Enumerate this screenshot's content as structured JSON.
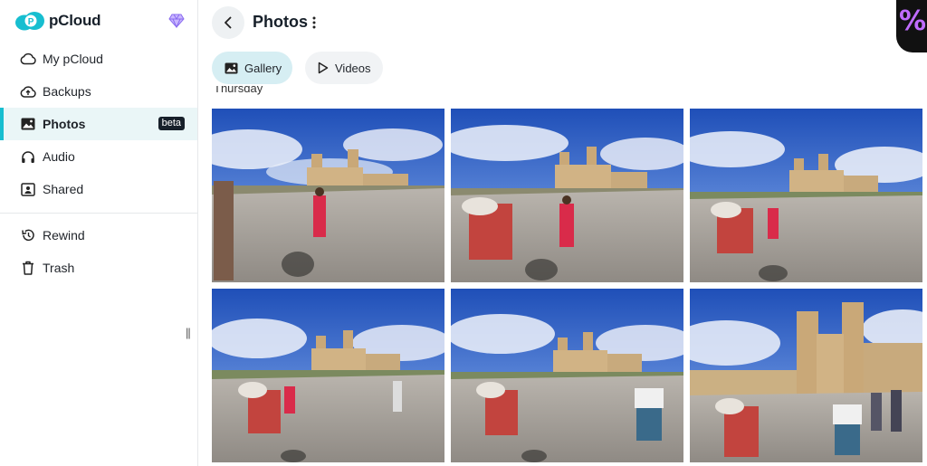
{
  "app": {
    "name": "pCloud"
  },
  "sidebar": {
    "items": [
      {
        "label": "My pCloud",
        "icon": "cloud-icon"
      },
      {
        "label": "Backups",
        "icon": "cloud-upload-icon"
      },
      {
        "label": "Photos",
        "icon": "image-icon",
        "active": true,
        "badge": "beta"
      },
      {
        "label": "Audio",
        "icon": "headphones-icon"
      },
      {
        "label": "Shared",
        "icon": "shared-folder-icon"
      }
    ],
    "secondary": [
      {
        "label": "Rewind",
        "icon": "rewind-icon"
      },
      {
        "label": "Trash",
        "icon": "trash-icon"
      }
    ],
    "collapse_glyph": "||"
  },
  "header": {
    "title": "Photos"
  },
  "tabs": [
    {
      "label": "Gallery",
      "icon": "image-icon",
      "active": true
    },
    {
      "label": "Videos",
      "icon": "play-icon",
      "active": false
    }
  ],
  "section": {
    "label": "Thursday"
  },
  "photos_count": 6,
  "corner_badge": "%",
  "colors": {
    "accent": "#17bed0",
    "active_bg": "#eaf6f7",
    "tab_active_bg": "#d6eef3",
    "badge_bg": "#17202a"
  }
}
